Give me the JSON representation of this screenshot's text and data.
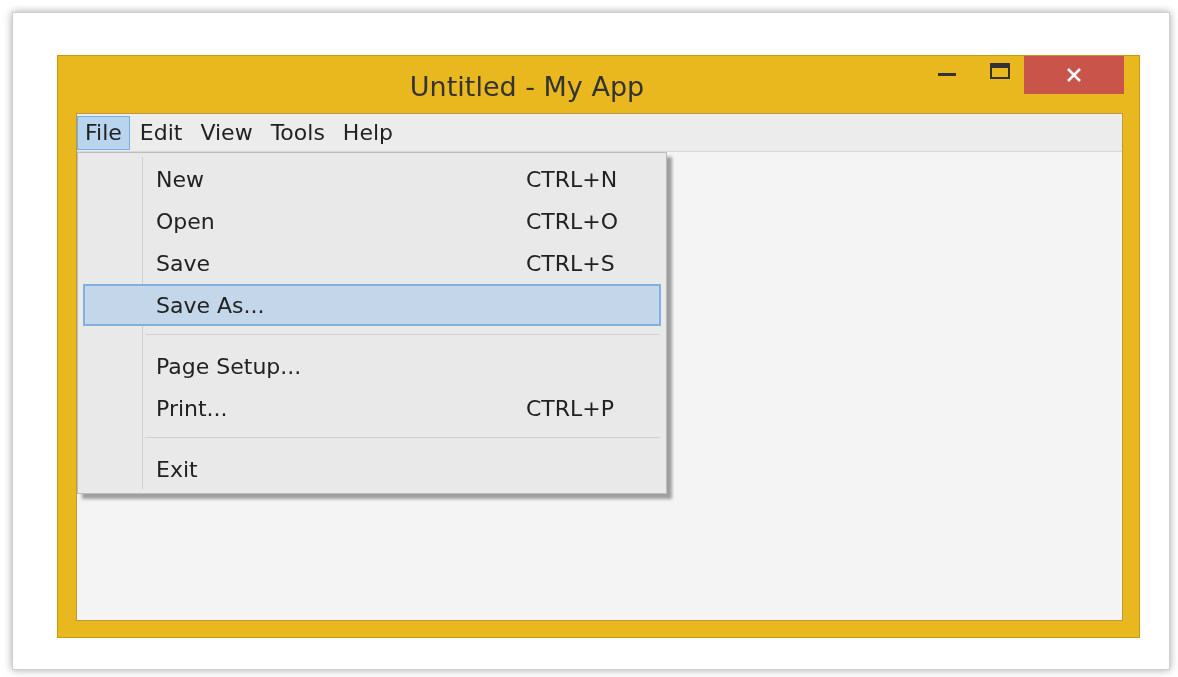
{
  "window": {
    "title": "Untitled - My App"
  },
  "menu_bar": [
    {
      "label": "File",
      "selected": true
    },
    {
      "label": "Edit",
      "selected": false
    },
    {
      "label": "View",
      "selected": false
    },
    {
      "label": "Tools",
      "selected": false
    },
    {
      "label": "Help",
      "selected": false
    }
  ],
  "file_menu": [
    {
      "kind": "item",
      "label": "New",
      "shortcut": "CTRL+N",
      "selected": false
    },
    {
      "kind": "item",
      "label": "Open",
      "shortcut": "CTRL+O",
      "selected": false
    },
    {
      "kind": "item",
      "label": "Save",
      "shortcut": "CTRL+S",
      "selected": false
    },
    {
      "kind": "item",
      "label": "Save As...",
      "selected": true
    },
    {
      "kind": "separator"
    },
    {
      "kind": "item",
      "label": "Page Setup...",
      "selected": false
    },
    {
      "kind": "item",
      "label": "Print...",
      "shortcut": "CTRL+P",
      "selected": false
    },
    {
      "kind": "separator"
    },
    {
      "kind": "item",
      "label": "Exit",
      "selected": false
    }
  ]
}
